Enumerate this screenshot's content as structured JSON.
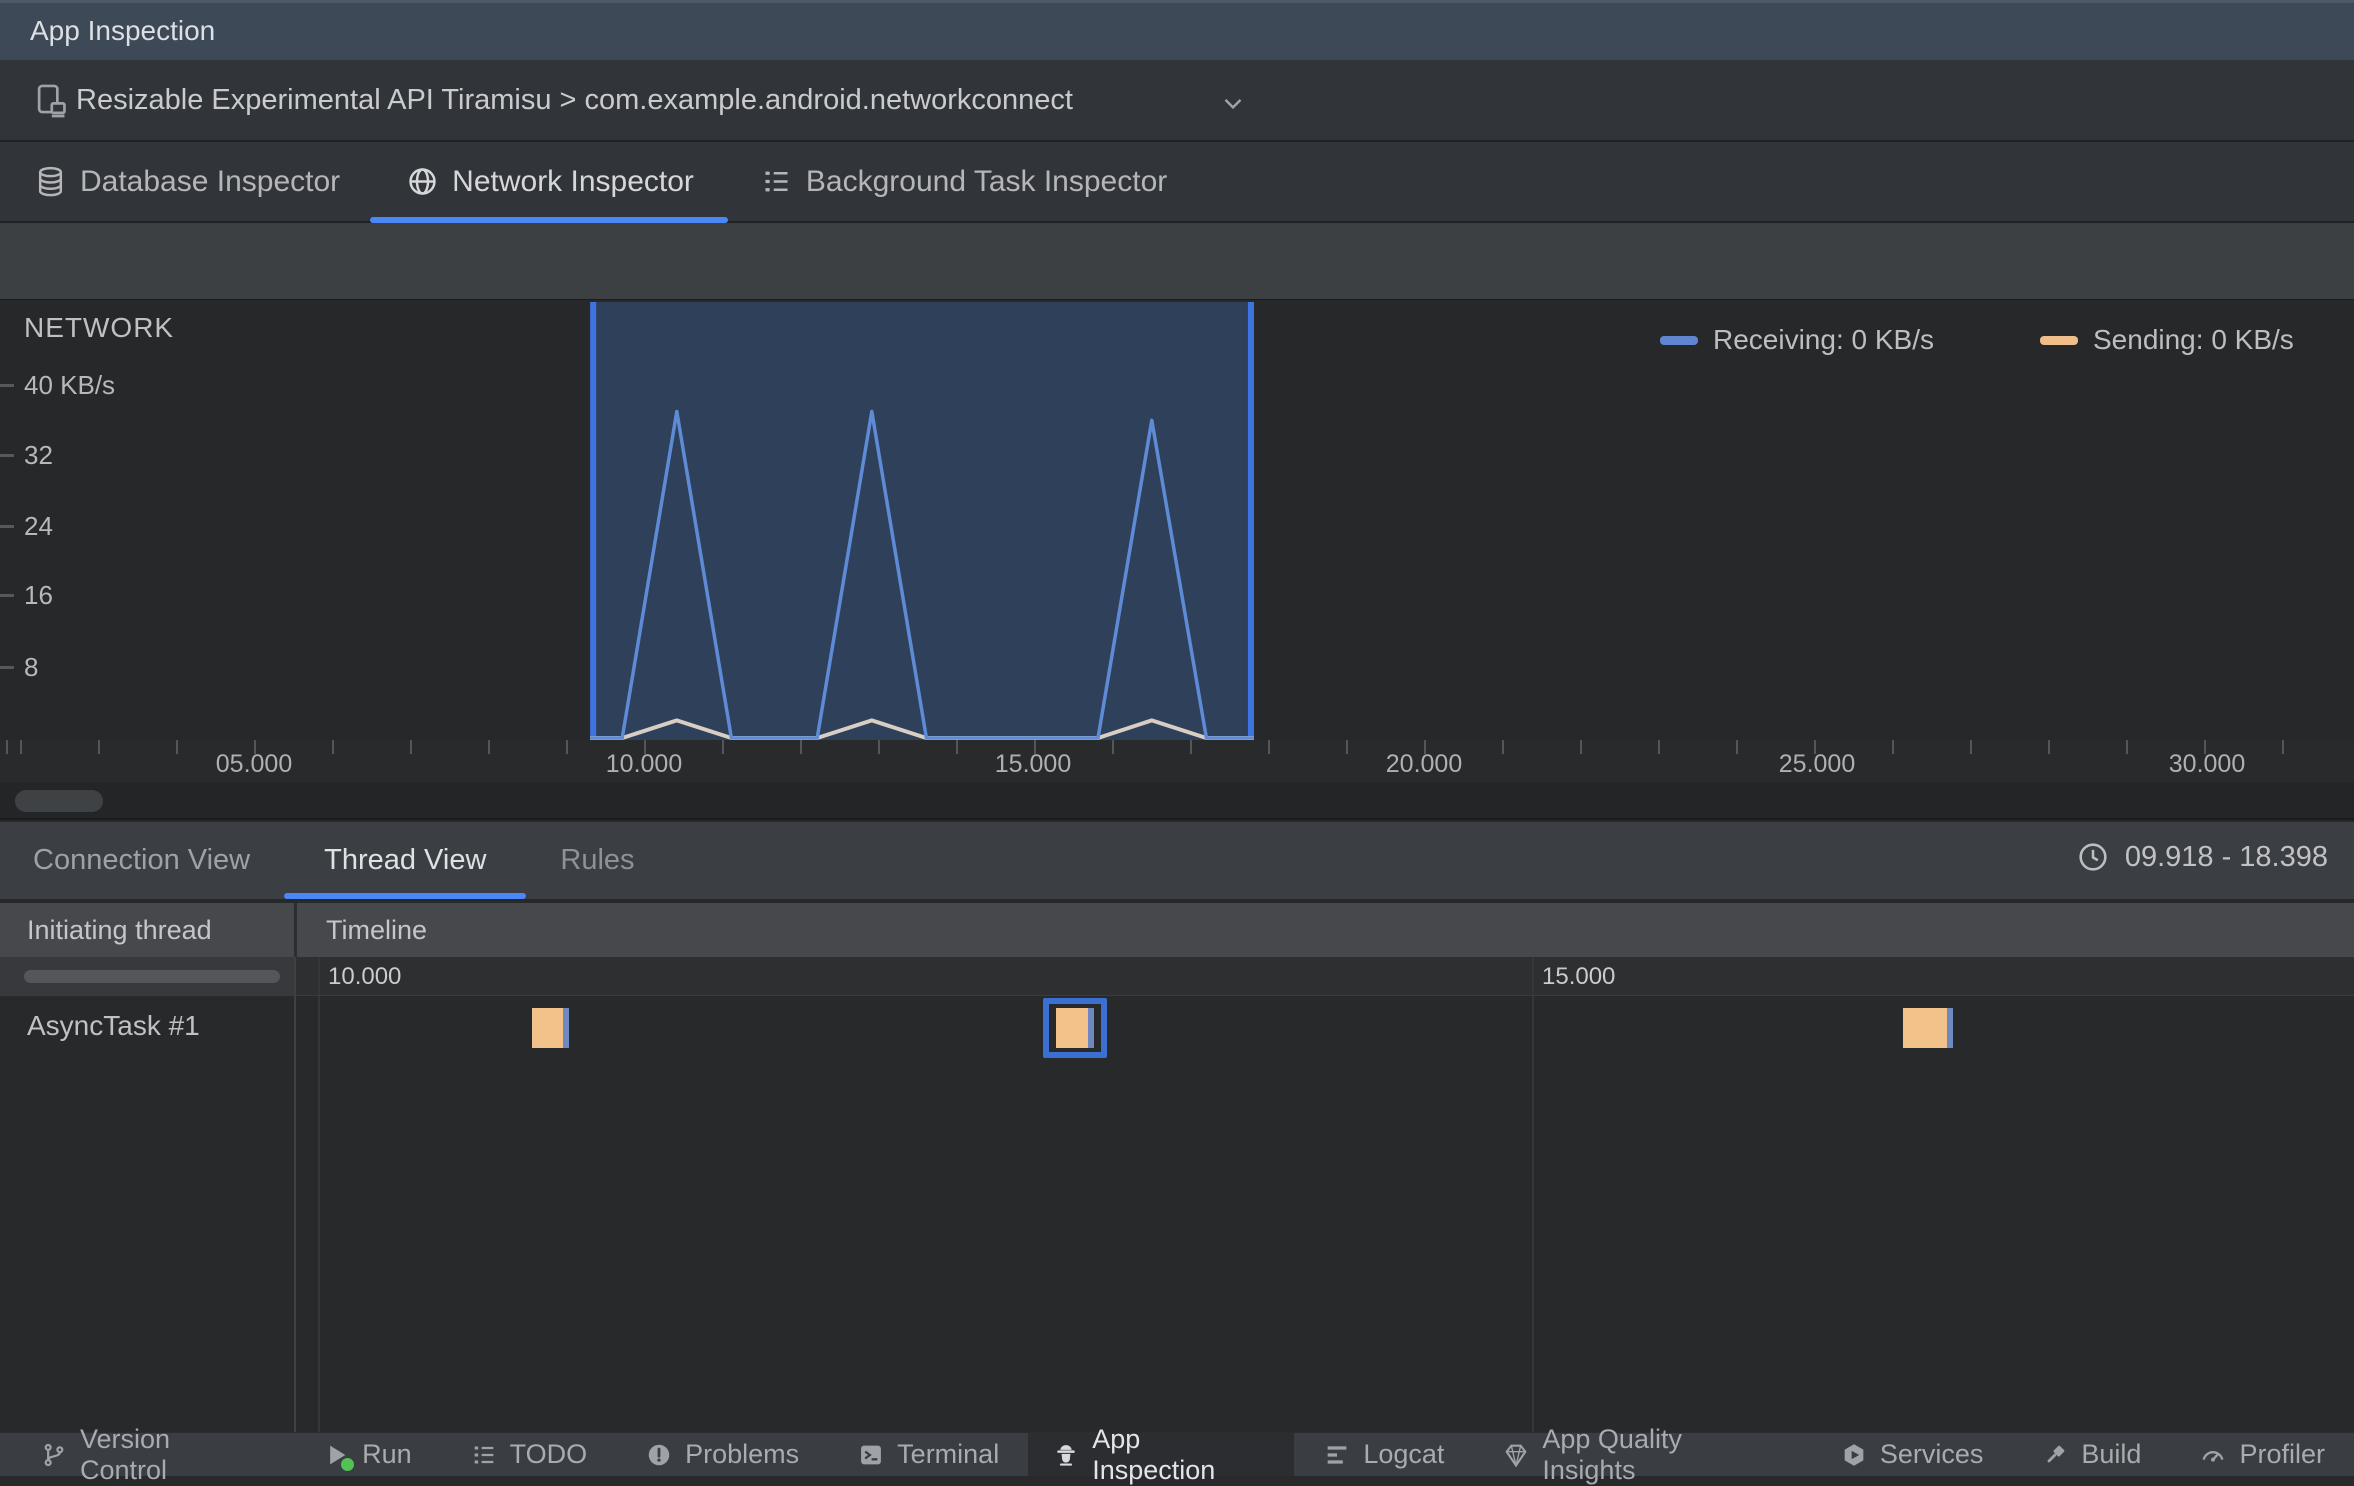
{
  "window": {
    "title": "App Inspection"
  },
  "device_bar": {
    "selection": "Resizable Experimental API Tiramisu > com.example.android.networkconnect"
  },
  "inspector_tabs": {
    "items": [
      {
        "label": "Database Inspector",
        "icon": "database-icon",
        "active": false
      },
      {
        "label": "Network Inspector",
        "icon": "globe-icon",
        "active": true
      },
      {
        "label": "Background Task Inspector",
        "icon": "list-icon",
        "active": false
      }
    ]
  },
  "network_chart": {
    "title": "NETWORK",
    "y_axis": {
      "labels": [
        "40 KB/s",
        "32",
        "24",
        "16",
        "8"
      ]
    },
    "x_axis": {
      "labels": [
        "05.000",
        "10.000",
        "15.000",
        "20.000",
        "25.000",
        "30.000"
      ]
    },
    "legend": [
      {
        "label": "Receiving: 0 KB/s",
        "color": "#6185D2"
      },
      {
        "label": "Sending: 0 KB/s",
        "color": "#EFBE8B"
      }
    ]
  },
  "chart_data": {
    "type": "line",
    "title": "NETWORK",
    "ylabel": "KB/s",
    "ylim": [
      0,
      40
    ],
    "x_unit": "seconds",
    "x_ticks": [
      5,
      10,
      15,
      20,
      25,
      30
    ],
    "grid": false,
    "legend_position": "top-right",
    "selection_window": {
      "label_start": "09.918",
      "label_end": "18.398",
      "rendered_start": 9.31,
      "rendered_end": 17.82
    },
    "series": [
      {
        "name": "Receiving",
        "color": "#5E8BD6",
        "points": [
          [
            9.31,
            0
          ],
          [
            9.72,
            0
          ],
          [
            10.42,
            37
          ],
          [
            11.12,
            0
          ],
          [
            12.22,
            0
          ],
          [
            12.92,
            37
          ],
          [
            13.62,
            0
          ],
          [
            15.82,
            0
          ],
          [
            16.51,
            36
          ],
          [
            17.21,
            0
          ],
          [
            17.82,
            0
          ]
        ]
      },
      {
        "name": "Sending",
        "color": "#D9CEC2",
        "points": [
          [
            9.31,
            0
          ],
          [
            9.72,
            0
          ],
          [
            10.42,
            2
          ],
          [
            11.12,
            0
          ],
          [
            12.22,
            0
          ],
          [
            12.92,
            2
          ],
          [
            13.62,
            0
          ],
          [
            15.82,
            0
          ],
          [
            16.51,
            2
          ],
          [
            17.21,
            0
          ],
          [
            17.82,
            0
          ]
        ]
      }
    ]
  },
  "detail_panel": {
    "tabs": [
      {
        "label": "Connection View",
        "active": false
      },
      {
        "label": "Thread View",
        "active": true
      },
      {
        "label": "Rules",
        "active": false
      }
    ],
    "time_range": "09.918 - 18.398",
    "table": {
      "columns": [
        "Initiating thread",
        "Timeline"
      ],
      "timeline_ticks": [
        {
          "label": "10.000",
          "t": 10
        },
        {
          "label": "15.000",
          "t": 15
        }
      ],
      "rows": [
        {
          "thread": "AsyncTask #1",
          "events": [
            {
              "start": 10.88,
              "end": 11.01,
              "selected": false
            },
            {
              "start": 13.04,
              "end": 13.17,
              "selected": true
            },
            {
              "start": 16.53,
              "end": 16.71,
              "selected": false
            }
          ]
        }
      ]
    }
  },
  "status_bar": {
    "items": [
      {
        "label": "Version Control",
        "icon": "branch-icon",
        "active": false
      },
      {
        "label": "Run",
        "icon": "run-icon",
        "active": false
      },
      {
        "label": "TODO",
        "icon": "todo-icon",
        "active": false
      },
      {
        "label": "Problems",
        "icon": "problems-icon",
        "active": false
      },
      {
        "label": "Terminal",
        "icon": "terminal-icon",
        "active": false
      },
      {
        "label": "App Inspection",
        "icon": "spy-icon",
        "active": true
      },
      {
        "label": "Logcat",
        "icon": "logcat-icon",
        "active": false
      },
      {
        "label": "App Quality Insights",
        "icon": "gem-icon",
        "active": false
      },
      {
        "label": "Services",
        "icon": "services-icon",
        "active": false
      },
      {
        "label": "Build",
        "icon": "build-icon",
        "active": false
      },
      {
        "label": "Profiler",
        "icon": "profiler-icon",
        "active": false
      }
    ],
    "run_status_color": "#52C255"
  }
}
